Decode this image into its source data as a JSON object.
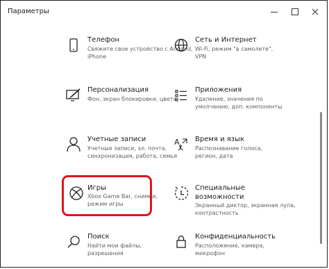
{
  "window": {
    "title": "Параметры"
  },
  "tiles": [
    {
      "name": "Телефон",
      "desc1": "Свяжите свое устройство с Android,",
      "desc2": "iPhone"
    },
    {
      "name": "Сеть и Интернет",
      "desc1": "Wi-Fi, режим \"в самолете\",",
      "desc2": "VPN"
    },
    {
      "name": "Персонализация",
      "desc1": "Фон, экран блокировки, цвета",
      "desc2": ""
    },
    {
      "name": "Приложения",
      "desc1": "Удаление, значения по",
      "desc2": "умолчанию, доп. компоненты"
    },
    {
      "name": "Учетные записи",
      "desc1": "Учетные записи, эл. почта,",
      "desc2": "синхронизация, работа, семья"
    },
    {
      "name": "Время и язык",
      "desc1": "Распознавание голоса,",
      "desc2": "регион, дата"
    },
    {
      "name": "Игры",
      "desc1": "Xbox Game Bar, снимки,",
      "desc2": "режим игры"
    },
    {
      "name1": "Специальные",
      "name2": "возможности",
      "desc1": "Экранный диктор, экранная лупа,",
      "desc2": "контрастность"
    },
    {
      "name": "Поиск",
      "desc1": "Найти мои файлы,",
      "desc2": "разрешения"
    },
    {
      "name": "Конфиденциальность",
      "desc1": "Расположение, камера,",
      "desc2": "микрофон"
    }
  ]
}
